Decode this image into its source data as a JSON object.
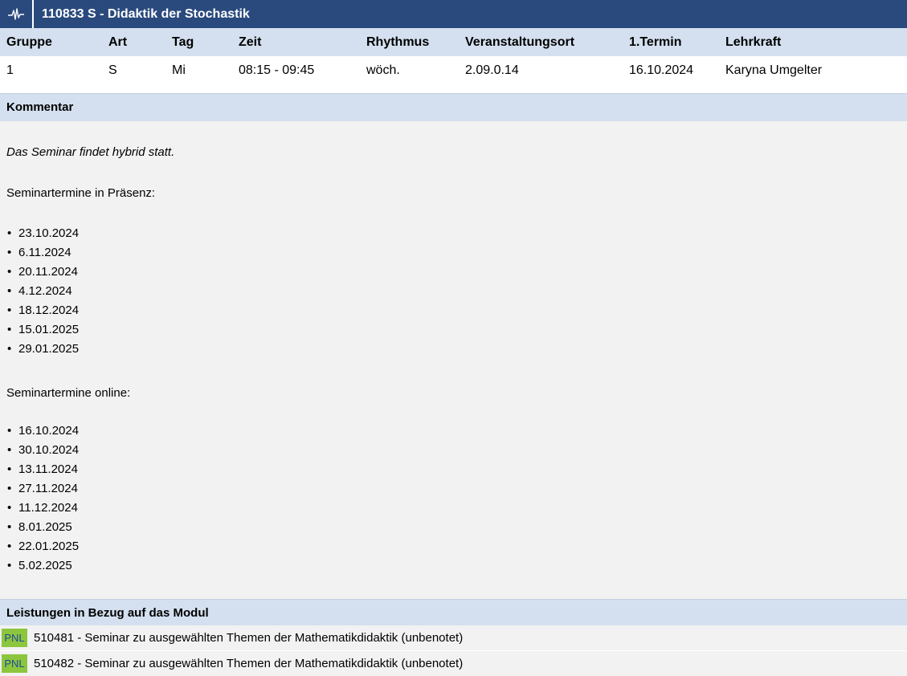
{
  "course": {
    "title": "110833 S - Didaktik der Stochastik",
    "icon": "waveform-icon"
  },
  "table": {
    "headers": [
      "Gruppe",
      "Art",
      "Tag",
      "Zeit",
      "Rhythmus",
      "Veranstaltungsort",
      "1.Termin",
      "Lehrkraft"
    ],
    "rows": [
      [
        "1",
        "S",
        "Mi",
        "08:15 - 09:45",
        "wöch.",
        "2.09.0.14",
        "16.10.2024",
        "Karyna Umgelter"
      ]
    ]
  },
  "comment": {
    "heading": "Kommentar",
    "intro": "Das Seminar findet hybrid statt.",
    "presence_label": "Seminartermine in Präsenz:",
    "presence_dates": [
      "23.10.2024",
      "6.11.2024",
      "20.11.2024",
      "4.12.2024",
      "18.12.2024",
      "15.01.2025",
      "29.01.2025"
    ],
    "online_label": "Seminartermine online:",
    "online_dates": [
      "16.10.2024",
      "30.10.2024",
      "13.11.2024",
      "27.11.2024",
      "11.12.2024",
      "8.01.2025",
      "22.01.2025",
      "5.02.2025"
    ],
    "bullet": "•"
  },
  "modul": {
    "heading": "Leistungen in Bezug auf das Modul",
    "items": [
      {
        "tag": "PNL",
        "text": "510481 - Seminar zu ausgewählten Themen der Mathematikdidaktik (unbenotet)"
      },
      {
        "tag": "PNL",
        "text": "510482 - Seminar zu ausgewählten Themen der Mathematikdidaktik (unbenotet)"
      }
    ]
  },
  "colors": {
    "title_bg": "#2a4a7e",
    "header_bg": "#d4e0ef",
    "comment_bg": "#f2f2f2",
    "pnl_bg": "#8cc63e"
  }
}
